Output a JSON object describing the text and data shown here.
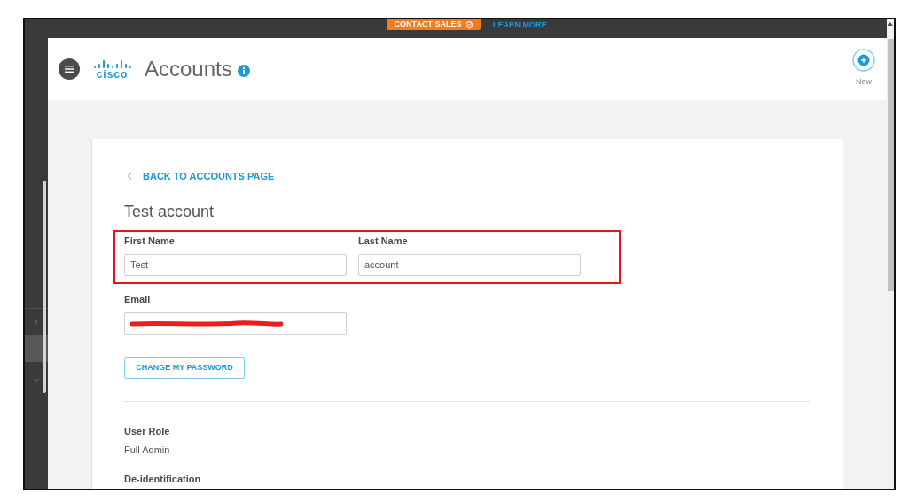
{
  "top_bar": {
    "contact_sales": "CONTACT SALES",
    "learn_more": "LEARN MORE"
  },
  "header": {
    "logo": "cisco",
    "title": "Accounts",
    "new_button": "New"
  },
  "card": {
    "back_link": "BACK TO ACCOUNTS PAGE",
    "heading": "Test account",
    "name_row": {
      "highlighted": true,
      "fields": [
        {
          "label": "First Name",
          "value": "Test"
        },
        {
          "label": "Last Name",
          "value": "account"
        }
      ]
    },
    "email": {
      "label": "Email",
      "redacted": true
    },
    "password_button": "CHANGE MY PASSWORD",
    "details": [
      {
        "label": "User Role",
        "value": "Full Admin"
      },
      {
        "label": "De-identification"
      }
    ]
  }
}
